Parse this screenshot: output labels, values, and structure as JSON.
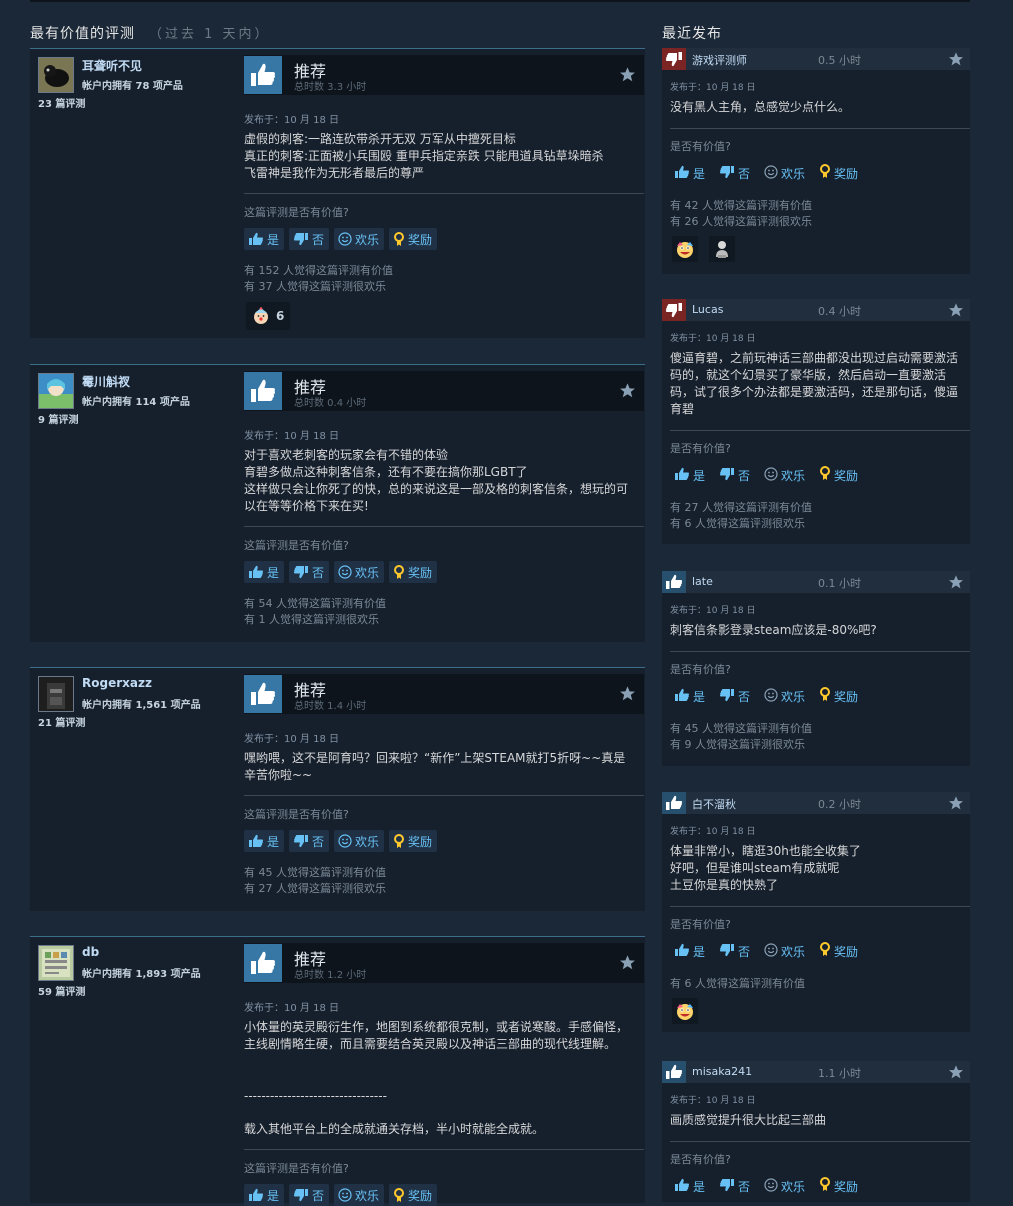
{
  "headers": {
    "most_helpful": "最有价值的评测",
    "most_helpful_sub": "（过去 1 天内）",
    "recent": "最近发布"
  },
  "colors": {
    "background": "#1b2838",
    "accent_link": "#67c1f5",
    "thumb_up": "#3777a6",
    "thumb_down": "#7b2424"
  },
  "buttons": {
    "yes": "是",
    "no": "否",
    "funny": "欢乐",
    "award": "奖励"
  },
  "helpful_question": "这篇评测是否有价值?",
  "recent_question": "是否有价值?",
  "left_reviews": [
    {
      "author": "耳聋听不见",
      "owned": "帐户内拥有 78 项产品",
      "review_count": "23 篇评测",
      "verdict": "推荐",
      "hours": "总时数 3.3 小时",
      "posted": "发布于：10 月 18 日",
      "text": "虚假的刺客:一路连砍带杀开无双 万军从中擅死目标\n真正的刺客:正面被小兵围殴 重甲兵指定亲跌 只能甩道具钻草垛暗杀\n飞雷神是我作为无形者最后的尊严",
      "helpful_stat": "有 152 人觉得这篇评测有价值",
      "funny_stat": "有 37 人觉得这篇评测很欢乐",
      "award_count": "6"
    },
    {
      "author": "霉川斛衩",
      "owned": "帐户内拥有 114 项产品",
      "review_count": "9 篇评测",
      "verdict": "推荐",
      "hours": "总时数 0.4 小时",
      "posted": "发布于：10 月 18 日",
      "text": "对于喜欢老刺客的玩家会有不错的体验\n育碧多做点这种刺客信条，还有不要在搞你那LGBT了\n这样做只会让你死了的快，总的来说这是一部及格的刺客信条，想玩的可以在等等价格下来在买!",
      "helpful_stat": "有 54 人觉得这篇评测有价值",
      "funny_stat": "有 1 人觉得这篇评测很欢乐"
    },
    {
      "author": "Rogerxazz",
      "owned": "帐户内拥有 1,561 项产品",
      "review_count": "21 篇评测",
      "verdict": "推荐",
      "hours": "总时数 1.4 小时",
      "posted": "发布于：10 月 18 日",
      "text": "嘿哟喂，这不是阿育吗？回来啦？“新作”上架STEAM就打5折呀~~真是辛苦你啦~~",
      "helpful_stat": "有 45 人觉得这篇评测有价值",
      "funny_stat": "有 27 人觉得这篇评测很欢乐"
    },
    {
      "author": "db",
      "owned": "帐户内拥有 1,893 项产品",
      "review_count": "59 篇评测",
      "verdict": "推荐",
      "hours": "总时数 1.2 小时",
      "posted": "发布于：10 月 18 日",
      "text": "小体量的英灵殿衍生作，地图到系统都很克制，或者说寒酸。手感偏怪，主线剧情略生硬，而且需要结合英灵殿以及神话三部曲的现代线理解。",
      "divider": "---------------------------------",
      "text2": "载入其他平台上的全成就通关存档，半小时就能全成就。"
    }
  ],
  "recent_reviews": [
    {
      "author": "游戏评测师",
      "hours": "0.5 小时",
      "verdict": "down",
      "posted": "发布于：10 月 18 日",
      "text": "没有黑人主角，总感觉少点什么。",
      "helpful_stat": "有 42 人觉得这篇评测有价值",
      "funny_stat": "有 26 人觉得这篇评测很欢乐"
    },
    {
      "author": "Lucas",
      "hours": "0.4 小时",
      "verdict": "down",
      "posted": "发布于：10 月 18 日",
      "text": "傻逼育碧，之前玩神话三部曲都没出现过启动需要激活码的，就这个幻景买了豪华版，然后启动一直要激活码，试了很多个办法都是要激活码，还是那句话，傻逼育碧",
      "helpful_stat": "有 27 人觉得这篇评测有价值",
      "funny_stat": "有 6 人觉得这篇评测很欢乐"
    },
    {
      "author": "late",
      "hours": "0.1 小时",
      "verdict": "up",
      "posted": "发布于：10 月 18 日",
      "text": "刺客信条影登录steam应该是-80%吧?",
      "helpful_stat": "有 45 人觉得这篇评测有价值",
      "funny_stat": "有 9 人觉得这篇评测很欢乐"
    },
    {
      "author": "白不溜秋",
      "hours": "0.2 小时",
      "verdict": "up",
      "posted": "发布于：10 月 18 日",
      "text": "体量非常小，瞎逛30h也能全收集了\n好吧，但是谁叫steam有成就呢\n土豆你是真的快熟了",
      "helpful_stat": "有 6 人觉得这篇评测有价值"
    },
    {
      "author": "misaka241",
      "hours": "1.1 小时",
      "verdict": "up",
      "posted": "发布于：10 月 18 日",
      "text": "画质感觉提升很大比起三部曲"
    }
  ]
}
